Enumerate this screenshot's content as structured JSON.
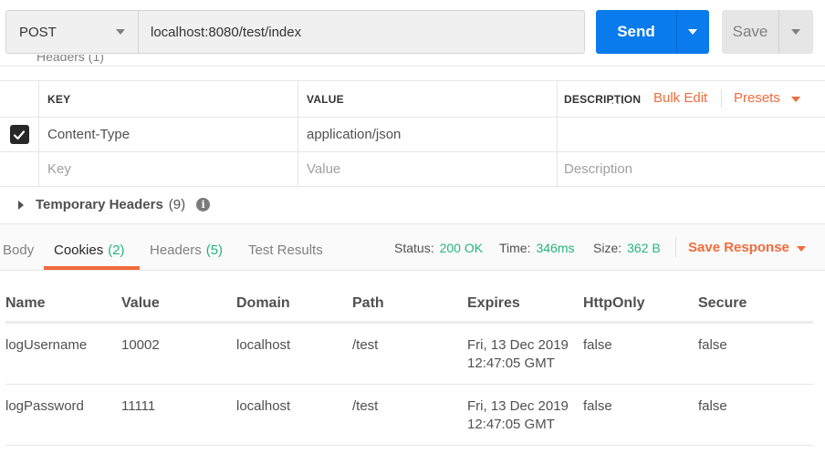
{
  "request": {
    "method": "POST",
    "url": "localhost:8080/test/index",
    "send_label": "Send",
    "save_label": "Save"
  },
  "headers_section": {
    "peek_label": "Headers (1)",
    "columns": {
      "key": "KEY",
      "value": "VALUE",
      "description": "DESCRIPTION"
    },
    "bulk_edit": "Bulk Edit",
    "presets": "Presets",
    "rows": [
      {
        "checked": true,
        "key": "Content-Type",
        "value": "application/json",
        "description": ""
      }
    ],
    "placeholders": {
      "key": "Key",
      "value": "Value",
      "description": "Description"
    }
  },
  "temporary_headers": {
    "label": "Temporary Headers",
    "count": "(9)",
    "info_icon": "info-icon"
  },
  "response": {
    "tabs": [
      {
        "label": "Body",
        "count": ""
      },
      {
        "label": "Cookies",
        "count": "(2)"
      },
      {
        "label": "Headers",
        "count": "(5)"
      },
      {
        "label": "Test Results",
        "count": ""
      }
    ],
    "active_tab": "Cookies",
    "status_label": "Status:",
    "status_value": "200 OK",
    "time_label": "Time:",
    "time_value": "346ms",
    "size_label": "Size:",
    "size_value": "362 B",
    "save_response": "Save Response"
  },
  "cookies": {
    "columns": [
      "Name",
      "Value",
      "Domain",
      "Path",
      "Expires",
      "HttpOnly",
      "Secure"
    ],
    "rows": [
      {
        "name": "logUsername",
        "value": "10002",
        "domain": "localhost",
        "path": "/test",
        "expires_line1": "Fri, 13 Dec 2019",
        "expires_line2": "12:47:05 GMT",
        "httponly": "false",
        "secure": "false"
      },
      {
        "name": "logPassword",
        "value": "11111",
        "domain": "localhost",
        "path": "/test",
        "expires_line1": "Fri, 13 Dec 2019",
        "expires_line2": "12:47:05 GMT",
        "httponly": "false",
        "secure": "false"
      }
    ]
  },
  "colors": {
    "accent": "#f26b3a",
    "primary": "#097bed",
    "success": "#26b47f"
  }
}
